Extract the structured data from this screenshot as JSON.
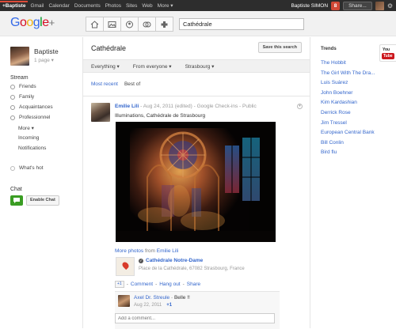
{
  "topbar": {
    "nav": [
      "+Baptiste",
      "Gmail",
      "Calendar",
      "Documents",
      "Photos",
      "Sites",
      "Web",
      "More ▾"
    ],
    "user_name": "Baptiste SIMON",
    "notification_count": "8",
    "share_label": "Share..."
  },
  "header": {
    "logo_plus": "+",
    "search_value": "Cathédrale"
  },
  "profile": {
    "name": "Baptiste",
    "pages": "1 page ▾"
  },
  "stream": {
    "label": "Stream",
    "circles": [
      "Friends",
      "Family",
      "Acquaintances",
      "Professionnel"
    ],
    "more": "More ▾",
    "incoming": "Incoming",
    "notifications": "Notifications",
    "whats_hot": "What's hot"
  },
  "chat": {
    "label": "Chat",
    "enable_label": "Enable Chat"
  },
  "main": {
    "title": "Cathédrale",
    "save_search_label": "Save this search",
    "filters": [
      "Everything ▾",
      "From everyone ▾",
      "Strasbourg ▾"
    ],
    "sort": {
      "recent": "Most recent",
      "best": "Best of"
    }
  },
  "post": {
    "author": "Emilie Lili",
    "meta": " - Aug 24, 2011 (edited) - Google Check-ins - Public",
    "text": "Illuminations, Cathédrale de Strasbourg",
    "more_photos": "More photos",
    "from": " from ",
    "place_name": "Cathédrale Notre-Dame",
    "place_address": "Place de la Cathédrale, 67082 Strasbourg, France",
    "plusone_small": "+1",
    "actions": {
      "comment": "Comment",
      "hangout": "Hang out",
      "share": "Share"
    }
  },
  "comment": {
    "author": "Axel Dr. Streule",
    "separator": " - ",
    "text": "Belle !!",
    "date": "Aug 22, 2011",
    "plusone": "+1",
    "add_placeholder": "Add a comment..."
  },
  "trends": {
    "title": "Trends",
    "items": [
      "The Hobbit",
      "The Girl With The Dra...",
      "Luis Suárez",
      "John Boehner",
      "Kim Kardashian",
      "Derrick Rose",
      "Jim Tressel",
      "European Central Bank",
      "Bill Conlin",
      "Bird flu"
    ]
  },
  "youtube": {
    "you": "You",
    "tube": "Tube"
  },
  "icons": [
    "home-icon",
    "photos-icon",
    "profile-icon",
    "circles-icon",
    "games-icon",
    "gear-icon",
    "checkin-icon"
  ]
}
